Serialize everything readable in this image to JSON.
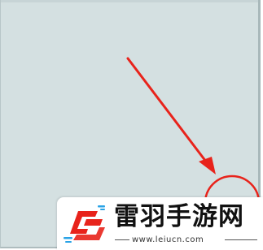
{
  "watermark": {
    "brand_name": "雷羽手游网",
    "url": "www.leiucn.com"
  },
  "annotation": {
    "arrow_color": "#e8231b",
    "circle_color": "#e8231b"
  },
  "colors": {
    "panel_background": "#d4e0e1",
    "logo_red": "#e8231b",
    "logo_blue": "#2aa3e6"
  },
  "icons": {
    "logo": "leiyu-logo-icon",
    "arrow": "red-arrow-icon",
    "highlight": "red-circle-highlight"
  }
}
